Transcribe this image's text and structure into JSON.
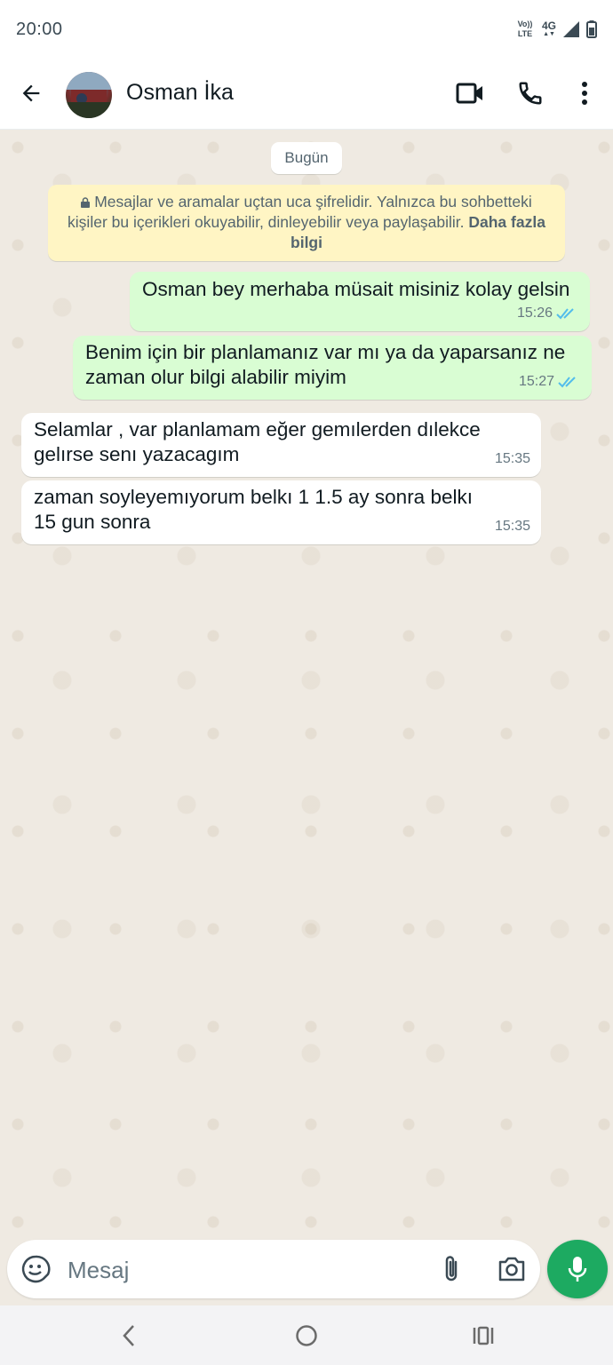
{
  "status_bar": {
    "time": "20:00",
    "volte": "Vo))\nLTE",
    "network": "4G",
    "icons": [
      "volte-icon",
      "signal-icon",
      "battery-icon"
    ]
  },
  "header": {
    "contact_name": "Osman İka",
    "icons": [
      "back-arrow-icon",
      "video-call-icon",
      "phone-icon",
      "more-vert-icon"
    ]
  },
  "chat": {
    "date_chip": "Bugün",
    "encryption_notice": {
      "text": "Mesajlar ve aramalar uçtan uca şifrelidir. Yalnızca bu sohbetteki kişiler bu içerikleri okuyabilir, dinleyebilir veya paylaşabilir.",
      "link": "Daha fazla bilgi"
    },
    "messages": [
      {
        "direction": "outgoing",
        "text": "Osman bey merhaba müsait misiniz kolay gelsin",
        "time": "15:26",
        "status": "read"
      },
      {
        "direction": "outgoing",
        "text": "Benim için bir planlamanız var mı ya da yaparsanız ne zaman olur bilgi alabilir miyim",
        "time": "15:27",
        "status": "read"
      },
      {
        "direction": "incoming",
        "text": "Selamlar , var planlamam eğer gemılerden dılekce gelırse senı yazacagım",
        "time": "15:35"
      },
      {
        "direction": "incoming",
        "text": "zaman soyleyemıyorum belkı 1 1.5 ay sonra belkı 15 gun sonra",
        "time": "15:35"
      }
    ]
  },
  "composer": {
    "placeholder": "Mesaj",
    "icons": [
      "emoji-sticker-icon",
      "attach-icon",
      "camera-icon",
      "mic-icon"
    ]
  },
  "colors": {
    "outgoing_bubble": "#d9fdd3",
    "incoming_bubble": "#ffffff",
    "chat_background": "#efeae2",
    "encryption_bg": "#fff5c4",
    "read_tick": "#53bdeb",
    "mic_button": "#1daa61"
  }
}
